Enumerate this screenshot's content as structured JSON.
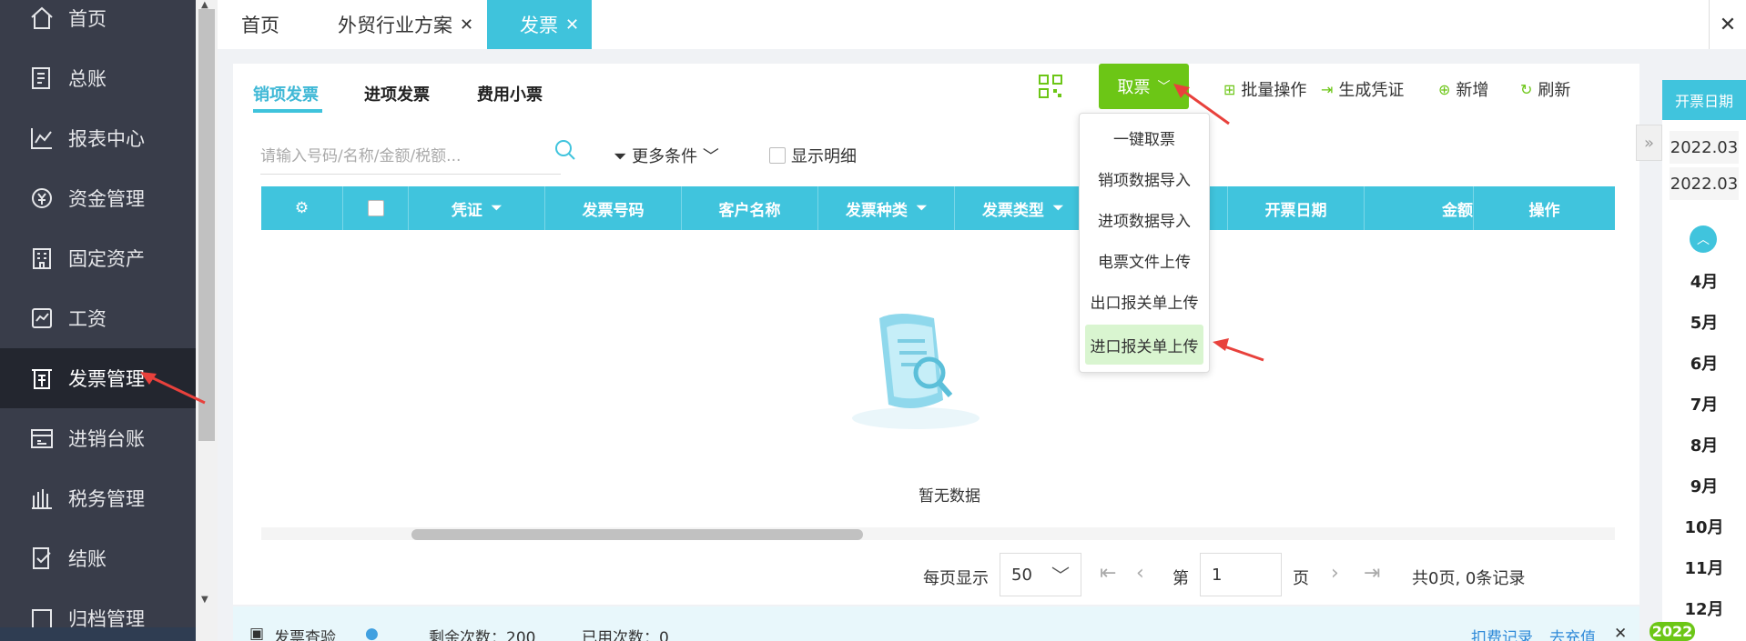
{
  "sidebar": {
    "items": [
      {
        "label": "首页",
        "icon": "home-icon"
      },
      {
        "label": "总账",
        "icon": "ledger-icon"
      },
      {
        "label": "报表中心",
        "icon": "chart-icon"
      },
      {
        "label": "资金管理",
        "icon": "money-icon"
      },
      {
        "label": "固定资产",
        "icon": "building-icon"
      },
      {
        "label": "工资",
        "icon": "salary-icon"
      },
      {
        "label": "发票管理",
        "icon": "invoice-icon"
      },
      {
        "label": "进销台账",
        "icon": "inventory-icon"
      },
      {
        "label": "税务管理",
        "icon": "tax-icon"
      },
      {
        "label": "结账",
        "icon": "close-period-icon"
      },
      {
        "label": "归档管理",
        "icon": "archive-icon"
      }
    ],
    "active_index": 6
  },
  "tabs": [
    {
      "label": "首页",
      "closable": false
    },
    {
      "label": "外贸行业方案",
      "closable": true
    },
    {
      "label": "发票",
      "closable": true,
      "active": true
    }
  ],
  "subtabs": [
    "销项发票",
    "进项发票",
    "费用小票"
  ],
  "toolbar": {
    "get_invoice": "取票",
    "batch": "批量操作",
    "voucher": "生成凭证",
    "add": "新增",
    "refresh": "刷新"
  },
  "search": {
    "placeholder": "请输入号码/名称/金额/税额..."
  },
  "filters": {
    "more": "更多条件",
    "show_detail": "显示明细"
  },
  "table": {
    "columns": [
      "凭证",
      "发票号码",
      "客户名称",
      "发票种类",
      "发票类型",
      "开票日期",
      "金额",
      "操作"
    ]
  },
  "empty_text": "暂无数据",
  "pager": {
    "per_page_label": "每页显示",
    "per_page": "50",
    "page_label": "第",
    "page": "1",
    "page_suffix": "页",
    "summary": "共0页, 0条记录"
  },
  "dropdown": {
    "items": [
      "一键取票",
      "销项数据导入",
      "进项数据导入",
      "电票文件上传",
      "出口报关单上传",
      "进口报关单上传"
    ],
    "highlighted_index": 5
  },
  "right_panel": {
    "header": "开票日期",
    "dates": [
      "2022.03",
      "2022.03"
    ],
    "months": [
      "4月",
      "5月",
      "6月",
      "7月",
      "8月",
      "9月",
      "10月",
      "11月",
      "12月"
    ],
    "year": "2022"
  },
  "bottom_bar": {
    "title": "发票查验",
    "remaining": "剩余次数：200",
    "used": "已用次数：0",
    "fee_record": "扣费记录",
    "recharge": "去充值"
  },
  "colors": {
    "accent": "#40c4dd",
    "green": "#6cc616",
    "sidebar_bg": "#393d4a",
    "annotation_arrow": "#e8413c"
  }
}
